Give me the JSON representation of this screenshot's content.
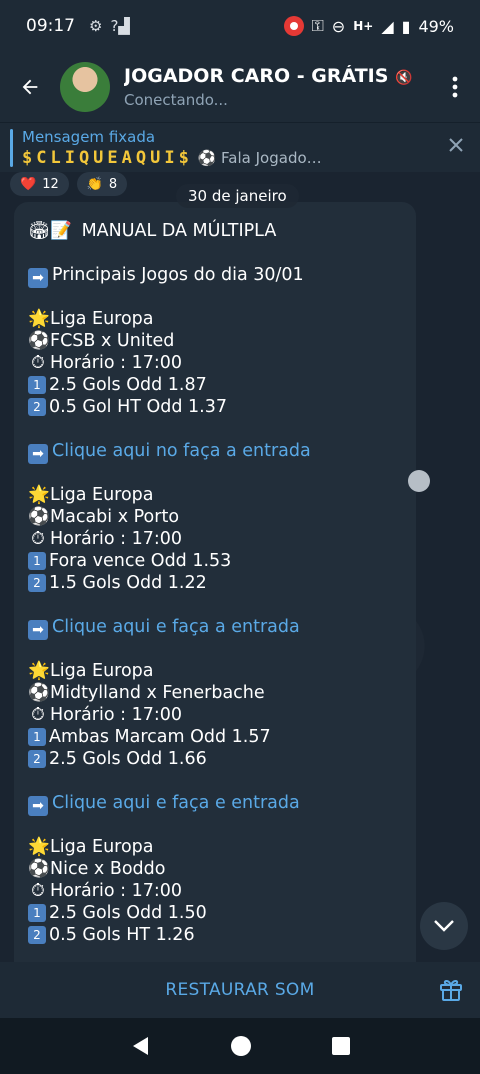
{
  "status_bar": {
    "time": "09:17",
    "battery": "49%",
    "network": "H+"
  },
  "header": {
    "title": "JOGADOR CARO - GRÁTIS",
    "subtitle": "Conectando..."
  },
  "pinned": {
    "title": "Mensagem fixada",
    "highlight": "$CLIQUEAQUI$",
    "preview": "⚽ Fala Jogado…"
  },
  "reactions": [
    {
      "emoji": "❤️",
      "count": "12"
    },
    {
      "emoji": "👏",
      "count": "8"
    }
  ],
  "date_pill": "30 de janeiro",
  "message": {
    "title": "MANUAL DA MÚLTIPLA",
    "intro": "Principais Jogos do dia 30/01",
    "games": [
      {
        "league": "Liga Europa",
        "match": "FCSB x United",
        "time": "Horário : 17:00",
        "tip1": "2.5 Gols Odd 1.87",
        "tip2": "0.5 Gol HT Odd 1.37",
        "link": "Clique aqui no faça a entrada"
      },
      {
        "league": "Liga Europa",
        "match": "Macabi x Porto",
        "time": "Horário : 17:00",
        "tip1": "Fora vence Odd 1.53",
        "tip2": "1.5 Gols Odd 1.22",
        "link": "Clique aqui e faça a entrada"
      },
      {
        "league": "Liga Europa",
        "match": "Midtylland x Fenerbache",
        "time": "Horário : 17:00",
        "tip1": "Ambas Marcam Odd 1.57",
        "tip2": "2.5 Gols Odd 1.66",
        "link": "Clique aqui e faça e entrada"
      },
      {
        "league": "Liga Europa",
        "match": "Nice x Boddo",
        "time": "Horário : 17:00",
        "tip1": "2.5 Gols Odd 1.50",
        "tip2": "0.5 Gols HT 1.26"
      }
    ]
  },
  "bottom": {
    "restore_label": "RESTAURAR SOM"
  },
  "colors": {
    "accent": "#5aa9e6",
    "bubble": "#222e3a",
    "gold": "#f3c73a"
  }
}
